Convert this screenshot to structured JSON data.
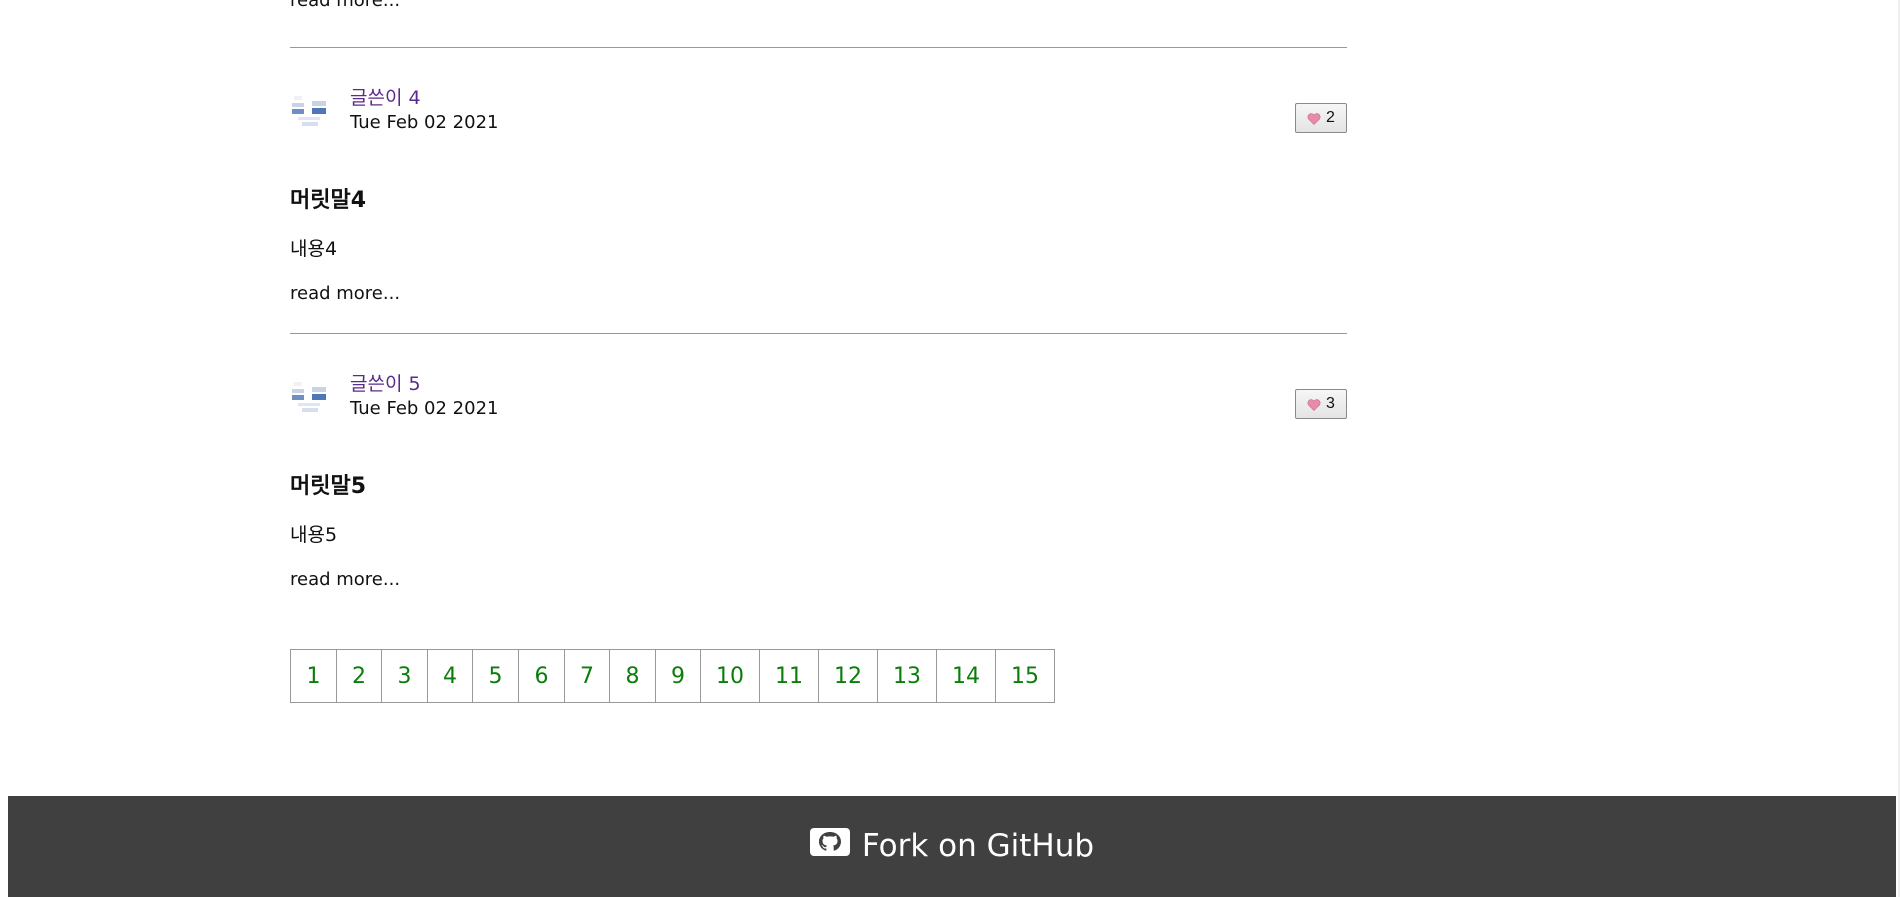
{
  "top_read_more": "read more...",
  "articles": [
    {
      "author": "글쓴이 4",
      "date": "Tue Feb 02 2021",
      "likes": "2",
      "title": "머릿말4",
      "body": "내용4",
      "read_more": "read more..."
    },
    {
      "author": "글쓴이 5",
      "date": "Tue Feb 02 2021",
      "likes": "3",
      "title": "머릿말5",
      "body": "내용5",
      "read_more": "read more..."
    }
  ],
  "pagination": {
    "pages": [
      "1",
      "2",
      "3",
      "4",
      "5",
      "6",
      "7",
      "8",
      "9",
      "10",
      "11",
      "12",
      "13",
      "14",
      "15"
    ]
  },
  "footer": {
    "fork_label": "Fork on GitHub",
    "icon": "github-icon"
  },
  "colors": {
    "author_link": "#5b2a8c",
    "page_link": "#0a7d0a",
    "footer_bg": "#404040",
    "heart": "#e98aa8"
  }
}
